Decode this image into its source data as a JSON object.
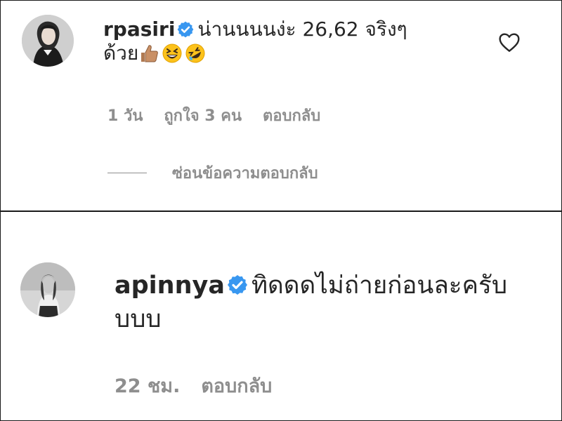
{
  "comments": [
    {
      "username": "rpasiri",
      "text_line1": "น่านนนนง่ะ 26,62 จริงๆ",
      "text_line2": "ด้วย",
      "emojis": [
        "thumbs-up-icon",
        "grinning-squinting-face-icon",
        "rolling-on-floor-laughing-icon"
      ],
      "time": "1 วัน",
      "likes": "ถูกใจ 3 คน",
      "reply_label": "ตอบกลับ",
      "hide_replies_label": "ซ่อนข้อความตอบกลับ",
      "verified": true
    },
    {
      "username": "apinnya",
      "text_line1": "ทิดดดไม่ถ่ายก่อนละครับ",
      "text_line2": "บบบ",
      "time": "22 ชม.",
      "reply_label": "ตอบกลับ",
      "verified": true
    }
  ],
  "colors": {
    "verified_badge": "#3897f0",
    "meta_text": "#8e8e8e",
    "primary_text": "#262626"
  }
}
